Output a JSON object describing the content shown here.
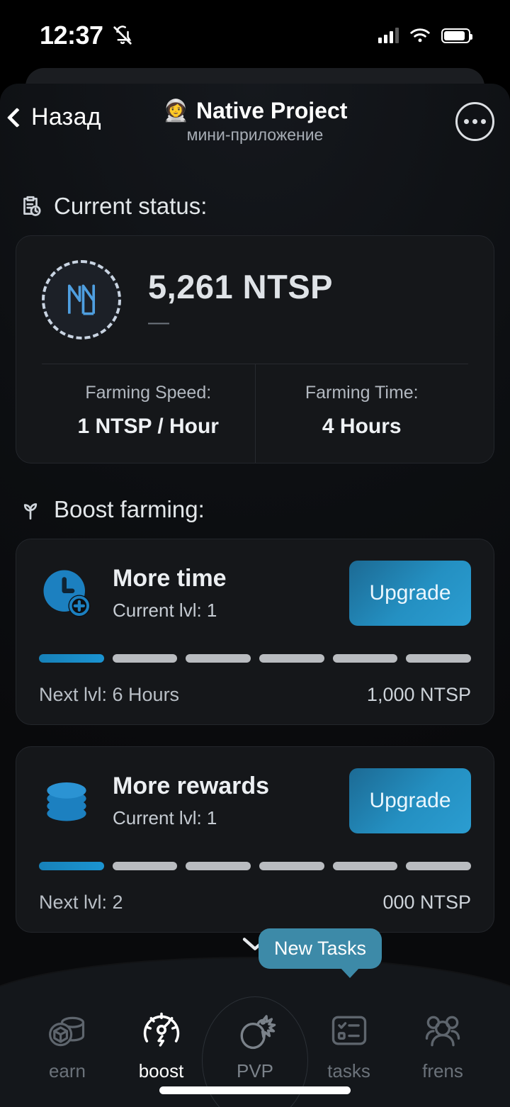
{
  "status_bar": {
    "time": "12:37",
    "mute_icon": "bell-slash-icon",
    "signal_icon": "cellular-signal-icon",
    "wifi_icon": "wifi-icon",
    "battery_icon": "battery-icon"
  },
  "header": {
    "back_label": "Назад",
    "back_icon": "chevron-left-icon",
    "emoji": "👩‍🚀",
    "title": "Native Project",
    "subtitle": "мини-приложение",
    "menu_icon": "more-options-icon"
  },
  "current_status": {
    "heading": "Current status:",
    "heading_icon": "clipboard-clock-icon",
    "logo_icon": "ntsp-logo-icon",
    "balance": "5,261 NTSP",
    "balance_sub": "—",
    "stats": [
      {
        "label": "Farming Speed:",
        "value": "1 NTSP / Hour"
      },
      {
        "label": "Farming Time:",
        "value": "4 Hours"
      }
    ]
  },
  "boost_farming": {
    "heading": "Boost farming:",
    "heading_icon": "sprout-icon",
    "cards": [
      {
        "icon": "clock-plus-icon",
        "name": "More time",
        "level": "Current lvl: 1",
        "button": "Upgrade",
        "segments_total": 6,
        "segments_filled": 1,
        "next_level": "Next lvl: 6 Hours",
        "cost": "1,000 NTSP"
      },
      {
        "icon": "coin-stack-icon",
        "name": "More rewards",
        "level": "Current lvl: 1",
        "button": "Upgrade",
        "segments_total": 6,
        "segments_filled": 1,
        "next_level": "Next lvl: 2",
        "cost": "000 NTSP"
      }
    ]
  },
  "bottom_nav": {
    "collapse_icon": "chevron-down-icon",
    "tooltip": "New Tasks",
    "items": [
      {
        "label": "earn",
        "icon": "coin-cube-icon",
        "active": false
      },
      {
        "label": "boost",
        "icon": "speedometer-icon",
        "active": true
      },
      {
        "label": "PVP",
        "icon": "bomb-icon",
        "active": false
      },
      {
        "label": "tasks",
        "icon": "checklist-icon",
        "active": false
      },
      {
        "label": "frens",
        "icon": "people-group-icon",
        "active": false
      }
    ]
  },
  "colors": {
    "accent": "#2490c2",
    "tooltip": "#3d8aa8",
    "card_bg": "#15171a",
    "sheet_bg": "#0d0f12"
  }
}
